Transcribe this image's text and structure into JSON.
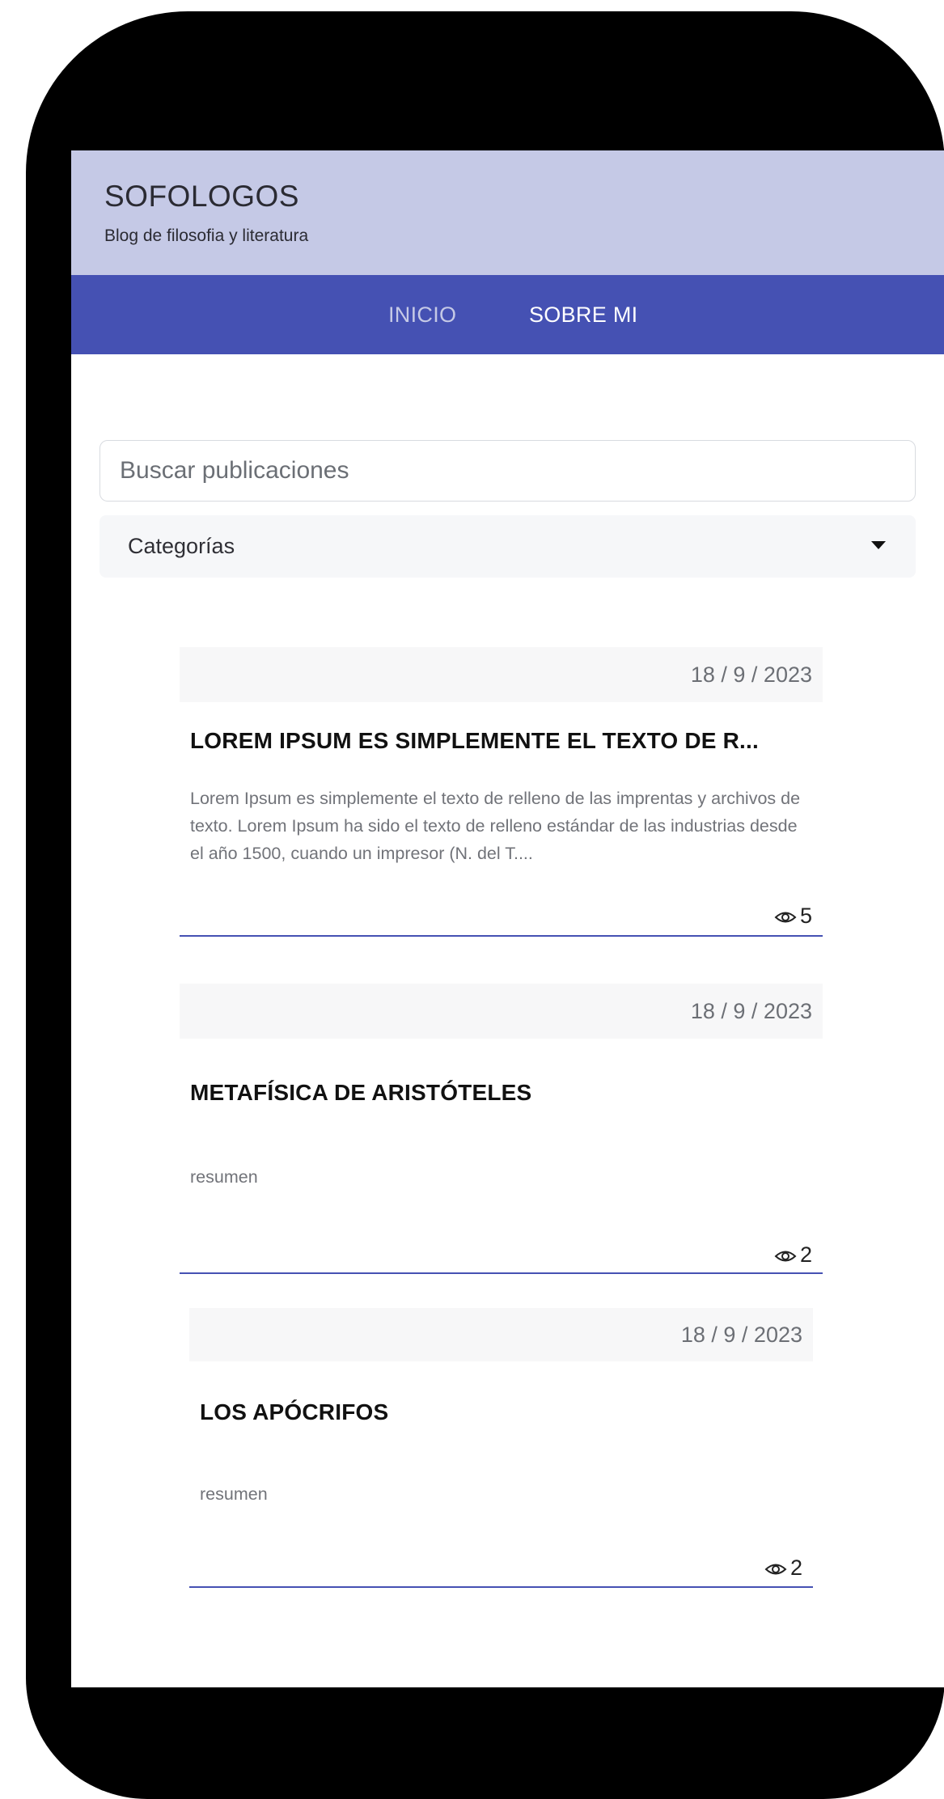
{
  "header": {
    "title": "SOFOLOGOS",
    "tagline": "Blog de filosofia y literatura"
  },
  "nav": {
    "items": [
      {
        "label": "INICIO"
      },
      {
        "label": "SOBRE MI"
      }
    ]
  },
  "search": {
    "placeholder": "Buscar publicaciones",
    "value": ""
  },
  "categories": {
    "label": "Categorías",
    "icon": "caret-down-icon"
  },
  "posts": [
    {
      "date": "18 / 9 / 2023",
      "title": "LOREM IPSUM ES SIMPLEMENTE EL TEXTO DE R...",
      "excerpt": "Lorem Ipsum es simplemente el texto de relleno de las imprentas y archivos de texto. Lorem Ipsum ha sido el texto de relleno estándar de las industrias desde el año 1500, cuando un impresor (N. del T....",
      "views": "5"
    },
    {
      "date": "18 / 9 / 2023",
      "title": "METAFÍSICA DE ARISTÓTELES",
      "excerpt": "resumen",
      "views": "2"
    },
    {
      "date": "18 / 9 / 2023",
      "title": "LOS APÓCRIFOS",
      "excerpt": "resumen",
      "views": "2"
    }
  ],
  "colors": {
    "header_bg": "#c5c9e6",
    "nav_bg": "#4551b3",
    "accent": "#4551b3",
    "frame": "#000000"
  }
}
